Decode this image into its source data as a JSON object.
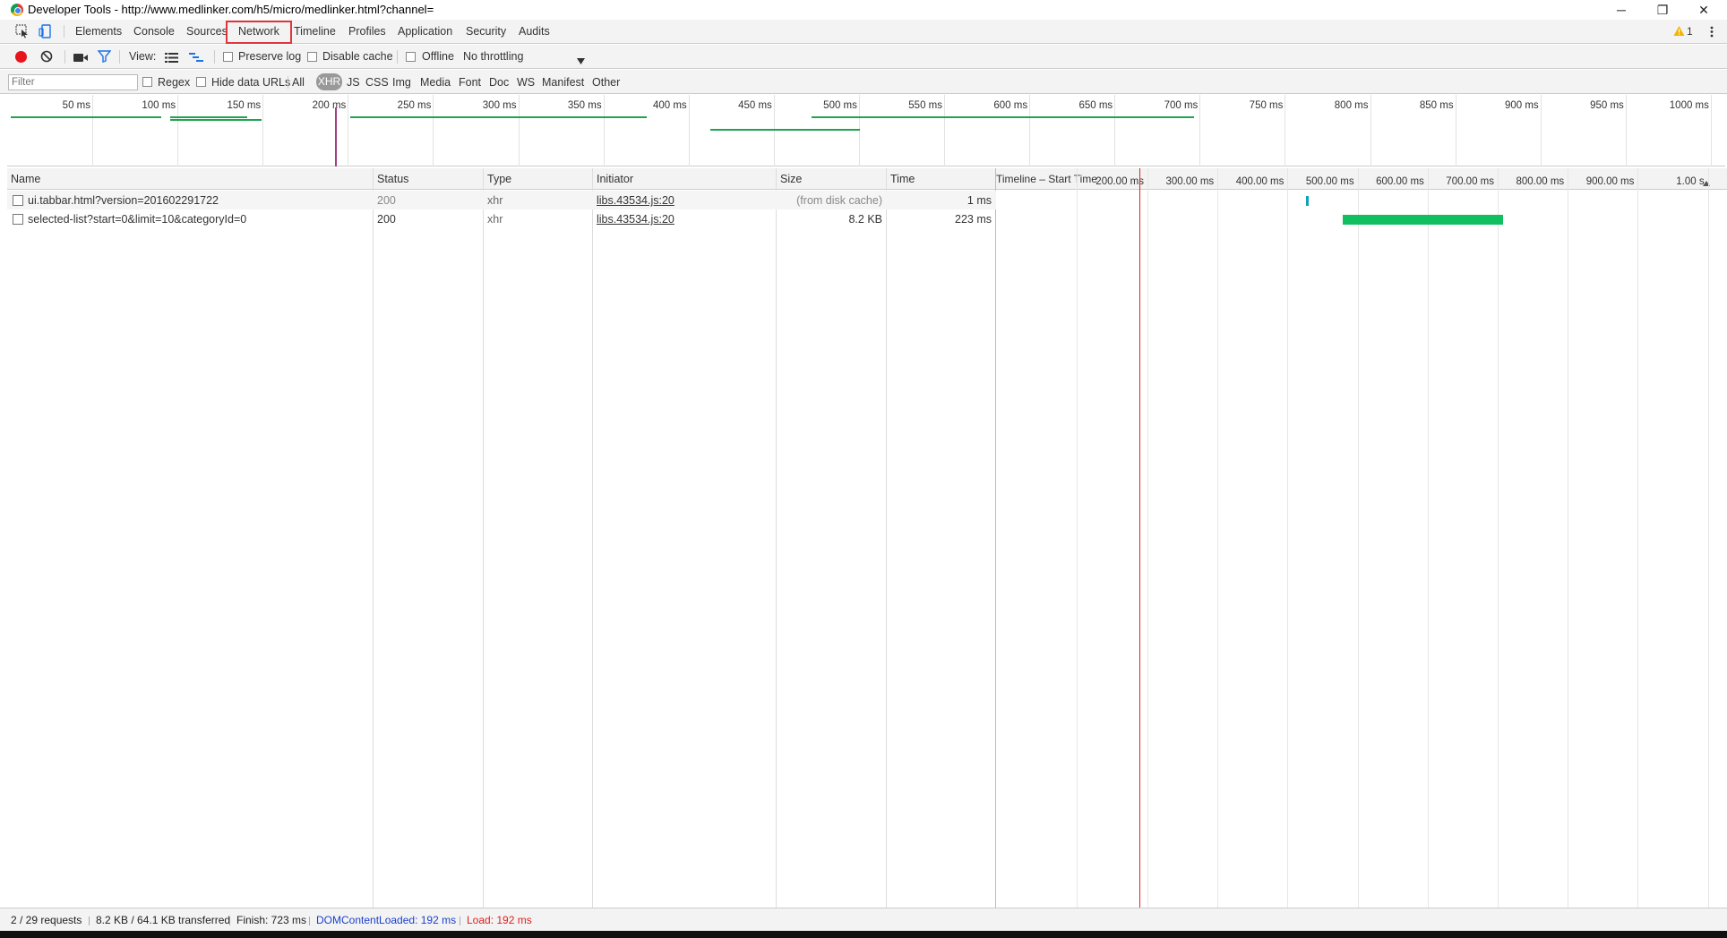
{
  "window": {
    "title": "Developer Tools - http://www.medlinker.com/h5/micro/medlinker.html?channel=",
    "minimize": "─",
    "maximize": "❐",
    "close": "✕"
  },
  "tabs": {
    "elements": "Elements",
    "console": "Console",
    "sources": "Sources",
    "network": "Network",
    "timeline": "Timeline",
    "profiles": "Profiles",
    "application": "Application",
    "security": "Security",
    "audits": "Audits",
    "warning_count": "1"
  },
  "toolbar": {
    "view_label": "View:",
    "preserve_log": "Preserve log",
    "disable_cache": "Disable cache",
    "offline": "Offline",
    "throttling": "No throttling"
  },
  "filter": {
    "placeholder": "Filter",
    "regex": "Regex",
    "hide_data_urls": "Hide data URLs",
    "types": {
      "all": "All",
      "xhr": "XHR",
      "js": "JS",
      "css": "CSS",
      "img": "Img",
      "media": "Media",
      "font": "Font",
      "doc": "Doc",
      "ws": "WS",
      "manifest": "Manifest",
      "other": "Other"
    }
  },
  "overview": {
    "ticks": [
      "50 ms",
      "100 ms",
      "150 ms",
      "200 ms",
      "250 ms",
      "300 ms",
      "350 ms",
      "400 ms",
      "450 ms",
      "500 ms",
      "550 ms",
      "600 ms",
      "650 ms",
      "700 ms",
      "750 ms",
      "800 ms",
      "850 ms",
      "900 ms",
      "950 ms",
      "1000 ms"
    ]
  },
  "table": {
    "headers": {
      "name": "Name",
      "status": "Status",
      "type": "Type",
      "initiator": "Initiator",
      "size": "Size",
      "time": "Time",
      "timeline": "Timeline – Start Time"
    },
    "waterfall_ticks": [
      "200.00 ms",
      "300.00 ms",
      "400.00 ms",
      "500.00 ms",
      "600.00 ms",
      "700.00 ms",
      "800.00 ms",
      "900.00 ms",
      "1.00 s"
    ],
    "rows": [
      {
        "name": "ui.tabbar.html?version=201602291722",
        "status": "200",
        "type": "xhr",
        "initiator": "libs.43534.js:20",
        "size": "(from disk cache)",
        "time": "1 ms"
      },
      {
        "name": "selected-list?start=0&limit=10&categoryId=0",
        "status": "200",
        "type": "xhr",
        "initiator": "libs.43534.js:20",
        "size": "8.2 KB",
        "time": "223 ms"
      }
    ]
  },
  "status": {
    "requests": "2 / 29 requests",
    "transferred": "8.2 KB / 64.1 KB transferred",
    "finish": "Finish: 723 ms",
    "dom_content_loaded": "DOMContentLoaded: 192 ms",
    "load": "Load: 192 ms"
  },
  "colors": {
    "record": "#e8131c",
    "highlight_box": "#e0353b",
    "bar_green": "#10c060",
    "bar_teal": "#11a0b8",
    "dcl_blue": "#1a3fd0",
    "load_red": "#e02020",
    "overview_green": "#1fa44d"
  }
}
